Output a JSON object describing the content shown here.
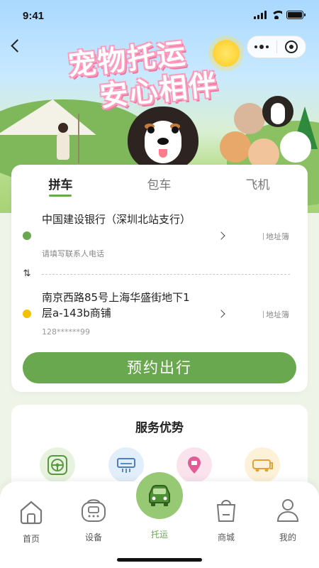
{
  "status_bar": {
    "time": "9:41"
  },
  "hero": {
    "title_line1": "宠物托运",
    "title_line2": "安心相伴"
  },
  "tabs": [
    {
      "label": "拼车",
      "active": true
    },
    {
      "label": "包车",
      "active": false
    },
    {
      "label": "飞机",
      "active": false
    }
  ],
  "pickup": {
    "address": "中国建设银行（深圳北站支行）",
    "placeholder": "请填写联系人电话",
    "address_book": "地址簿",
    "dot_color": "#6aa84f"
  },
  "dropoff": {
    "address": "南京西路85号上海华盛街地下1层a-143b商铺",
    "phone": "128******99",
    "address_book": "地址簿",
    "dot_color": "#f2c200"
  },
  "cta_label": "预约出行",
  "services": {
    "title": "服务优势",
    "icons": [
      "steering-wheel-icon",
      "ac-icon",
      "location-pin-icon",
      "van-icon"
    ]
  },
  "nav": {
    "items": [
      {
        "label": "首页",
        "icon": "home-icon"
      },
      {
        "label": "设备",
        "icon": "device-icon"
      },
      {
        "label": "托运",
        "icon": "car-icon",
        "active": true
      },
      {
        "label": "商城",
        "icon": "shopping-bag-icon"
      },
      {
        "label": "我的",
        "icon": "user-icon"
      }
    ]
  },
  "colors": {
    "accent": "#6aa84f"
  }
}
